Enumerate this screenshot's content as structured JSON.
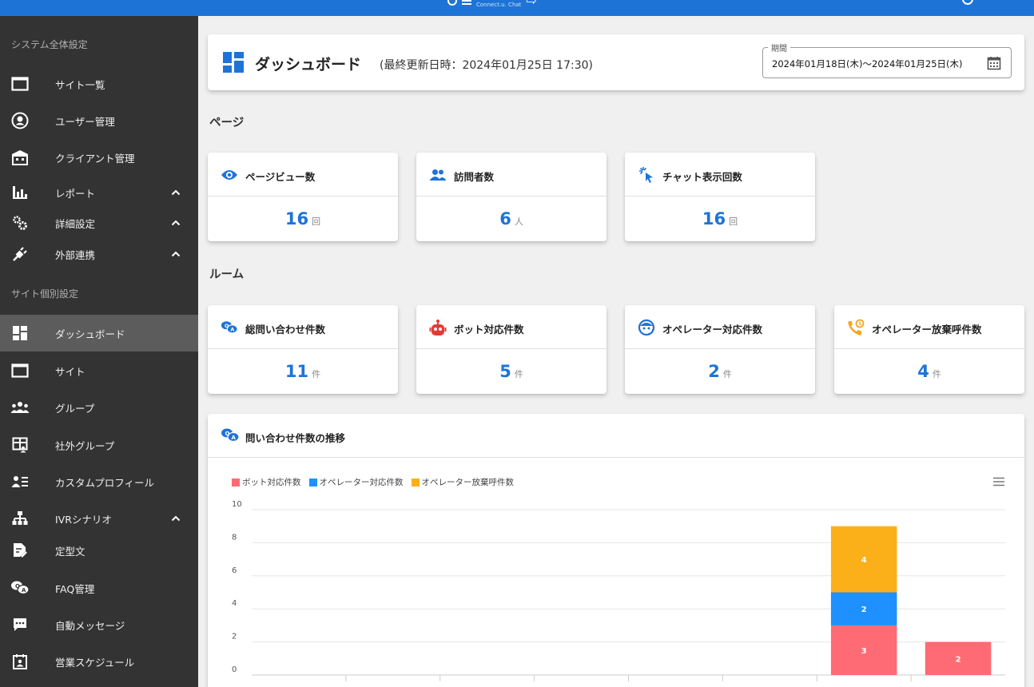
{
  "topbar": {
    "logo_tag": "Connect.u. Chat",
    "brand_color": "#1e74d6"
  },
  "sidebar": {
    "section_global": "システム全体設定",
    "section_site": "サイト個別設定",
    "items": [
      {
        "label": "サイト一覧",
        "icon": "window-icon"
      },
      {
        "label": "ユーザー管理",
        "icon": "user-circle-icon"
      },
      {
        "label": "クライアント管理",
        "icon": "building-icon"
      },
      {
        "label": "レポート",
        "icon": "bar-chart-icon"
      },
      {
        "label": "詳細設定",
        "icon": "gears-icon"
      },
      {
        "label": "外部連携",
        "icon": "plug-icon"
      },
      {
        "label": "ダッシュボード",
        "icon": "dashboard-icon"
      },
      {
        "label": "サイト",
        "icon": "window-icon"
      },
      {
        "label": "グループ",
        "icon": "group-icon"
      },
      {
        "label": "社外グループ",
        "icon": "external-group-icon"
      },
      {
        "label": "カスタムプロフィール",
        "icon": "profile-list-icon"
      },
      {
        "label": "IVRシナリオ",
        "icon": "sitemap-icon"
      },
      {
        "label": "定型文",
        "icon": "document-edit-icon"
      },
      {
        "label": "FAQ管理",
        "icon": "faq-icon"
      },
      {
        "label": "自動メッセージ",
        "icon": "message-icon"
      },
      {
        "label": "営業スケジュール",
        "icon": "calendar-person-icon"
      }
    ]
  },
  "header": {
    "title": "ダッシュボード",
    "updated": "(最終更新日時：2024年01月25日 17:30)",
    "period_label": "期間",
    "period_value": "2024年01月18日(木)〜2024年01月25日(木)"
  },
  "sections": {
    "page": "ページ",
    "room": "ルーム"
  },
  "page_stats": [
    {
      "label": "ページビュー数",
      "value": "16",
      "unit": "回",
      "icon": "eye-icon"
    },
    {
      "label": "訪問者数",
      "value": "6",
      "unit": "人",
      "icon": "people-icon"
    },
    {
      "label": "チャット表示回数",
      "value": "16",
      "unit": "回",
      "icon": "cursor-click-icon"
    }
  ],
  "room_stats": [
    {
      "label": "総問い合わせ件数",
      "value": "11",
      "unit": "件",
      "icon": "chat-bubbles-icon"
    },
    {
      "label": "ボット対応件数",
      "value": "5",
      "unit": "件",
      "icon": "robot-icon"
    },
    {
      "label": "オペレーター対応件数",
      "value": "2",
      "unit": "件",
      "icon": "operator-icon"
    },
    {
      "label": "オペレーター放棄呼件数",
      "value": "4",
      "unit": "件",
      "icon": "missed-call-icon"
    }
  ],
  "chart_title": "問い合わせ件数の推移",
  "chart_data": {
    "type": "bar",
    "stacked": true,
    "ylim": [
      0,
      10
    ],
    "yticks": [
      0,
      2,
      4,
      6,
      8,
      10
    ],
    "category_count": 8,
    "series": [
      {
        "name": "ボット対応件数",
        "color": "#ff6b74",
        "values": [
          0,
          0,
          0,
          0,
          0,
          0,
          3,
          2
        ]
      },
      {
        "name": "オペレーター対応件数",
        "color": "#1e90ff",
        "values": [
          0,
          0,
          0,
          0,
          0,
          0,
          2,
          0
        ]
      },
      {
        "name": "オペレーター放棄呼件数",
        "color": "#fbb01a",
        "values": [
          0,
          0,
          0,
          0,
          0,
          0,
          4,
          0
        ]
      }
    ],
    "grid": true,
    "legend_position": "top-left"
  }
}
